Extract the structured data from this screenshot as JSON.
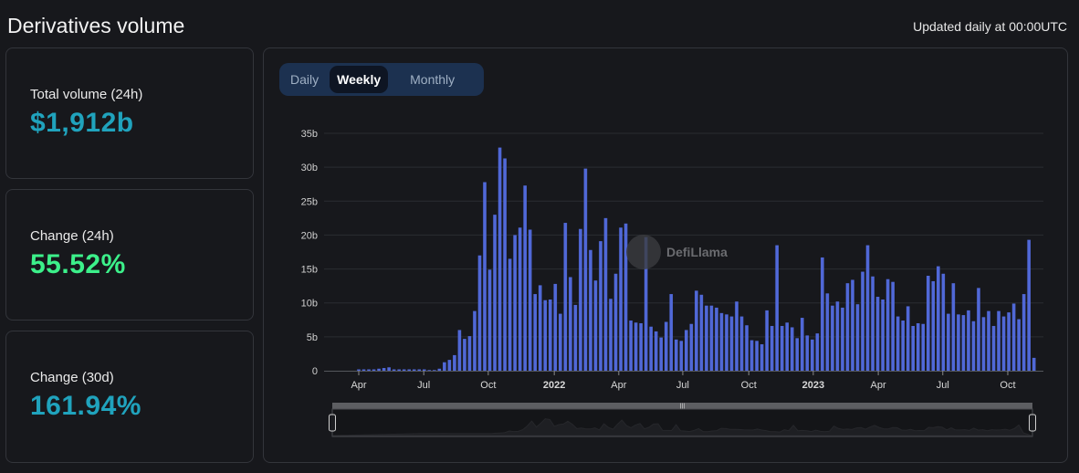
{
  "header": {
    "title": "Derivatives volume",
    "updated": "Updated daily at 00:00UTC"
  },
  "stats": [
    {
      "label": "Total volume (24h)",
      "value": "$1,912b",
      "color": "#20a3bd"
    },
    {
      "label": "Change (24h)",
      "value": "55.52%",
      "color": "#3cf08a"
    },
    {
      "label": "Change (30d)",
      "value": "161.94%",
      "color": "#20a3bd"
    }
  ],
  "toggle": {
    "options": [
      "Daily",
      "Weekly",
      "Monthly"
    ],
    "selected": "Weekly"
  },
  "watermark": "DefiLlama",
  "chart_data": {
    "type": "bar",
    "title": "",
    "xlabel": "",
    "ylabel": "",
    "bar_color": "#5068d7",
    "ylim": [
      0,
      35
    ],
    "yticks": [
      {
        "v": 0,
        "label": "0"
      },
      {
        "v": 5,
        "label": "5b"
      },
      {
        "v": 10,
        "label": "10b"
      },
      {
        "v": 15,
        "label": "15b"
      },
      {
        "v": 20,
        "label": "20b"
      },
      {
        "v": 25,
        "label": "25b"
      },
      {
        "v": 30,
        "label": "30b"
      },
      {
        "v": 35,
        "label": "35b"
      }
    ],
    "xticks": [
      {
        "i": 0,
        "label": "Apr"
      },
      {
        "i": 12.9,
        "label": "Jul"
      },
      {
        "i": 25.7,
        "label": "Oct"
      },
      {
        "i": 38.8,
        "label": "2022",
        "bold": true
      },
      {
        "i": 51.6,
        "label": "Apr"
      },
      {
        "i": 64.3,
        "label": "Jul"
      },
      {
        "i": 77.4,
        "label": "Oct"
      },
      {
        "i": 90.2,
        "label": "2023",
        "bold": true
      },
      {
        "i": 103.1,
        "label": "Apr"
      },
      {
        "i": 115.9,
        "label": "Jul"
      },
      {
        "i": 128.8,
        "label": "Oct"
      }
    ],
    "unit": "b (USD billions, weekly)",
    "values": [
      0.2,
      0.2,
      0.2,
      0.2,
      0.3,
      0.4,
      0.5,
      0.2,
      0.2,
      0.2,
      0.2,
      0.2,
      0.2,
      0.2,
      0.1,
      0.1,
      0.3,
      1.25,
      1.6,
      2.3,
      6.0,
      4.7,
      5.1,
      8.8,
      17,
      27.8,
      14.9,
      23,
      32.9,
      31.3,
      16.5,
      20,
      21.1,
      27.3,
      20.8,
      11.3,
      12.6,
      10.4,
      10.5,
      12.8,
      8.4,
      21.8,
      13.8,
      9.7,
      20.9,
      29.8,
      17.8,
      13.3,
      19.1,
      22.5,
      10.6,
      14.3,
      21.1,
      21.7,
      7.4,
      7.1,
      7.0,
      19.7,
      6.5,
      5.8,
      4.9,
      7.2,
      11.3,
      4.6,
      4.4,
      6.0,
      6.9,
      11.8,
      11.2,
      9.6,
      9.6,
      9.3,
      8.5,
      8.3,
      8.0,
      10.2,
      8.0,
      6.7,
      4.5,
      4.4,
      3.9,
      8.9,
      6.6,
      18.5,
      6.6,
      7.1,
      6.4,
      4.8,
      7.8,
      5.2,
      4.6,
      5.5,
      16.7,
      11.4,
      9.6,
      10.2,
      9.3,
      12.9,
      13.4,
      9.8,
      14.6,
      18.5,
      13.9,
      10.9,
      10.5,
      13.5,
      13.1,
      8.0,
      7.4,
      9.5,
      6.6,
      7.0,
      6.9,
      14.0,
      13.2,
      15.4,
      14.3,
      8.4,
      12.9,
      8.3,
      8.2,
      8.9,
      7.3,
      12.2,
      7.9,
      8.8,
      6.6,
      8.8,
      8.0,
      8.6,
      9.9,
      7.6,
      11.3,
      19.3,
      1.9
    ]
  }
}
